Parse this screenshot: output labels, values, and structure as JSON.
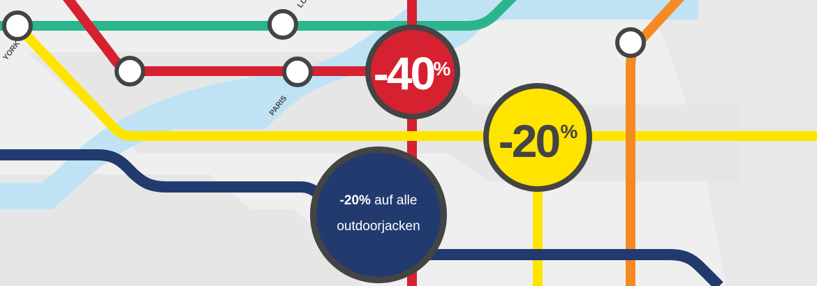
{
  "banner": {
    "colors": {
      "background": "#efefef",
      "river": "#bfe3f5",
      "line_green": "#2bb58c",
      "line_red": "#d62131",
      "line_yellow": "#ffe400",
      "line_navy": "#223a6e",
      "line_orange": "#f58a25",
      "ring": "#444444"
    },
    "stations": {
      "york": "YORK",
      "paris": "PARIS",
      "london": "LO"
    },
    "badge_red": {
      "value": "-40",
      "percent": "%"
    },
    "badge_yellow": {
      "value": "-20",
      "percent": "%"
    },
    "badge_navy": {
      "highlight": "-20%",
      "line1_rest": " auf alle",
      "line2": "outdoorjacken"
    }
  }
}
